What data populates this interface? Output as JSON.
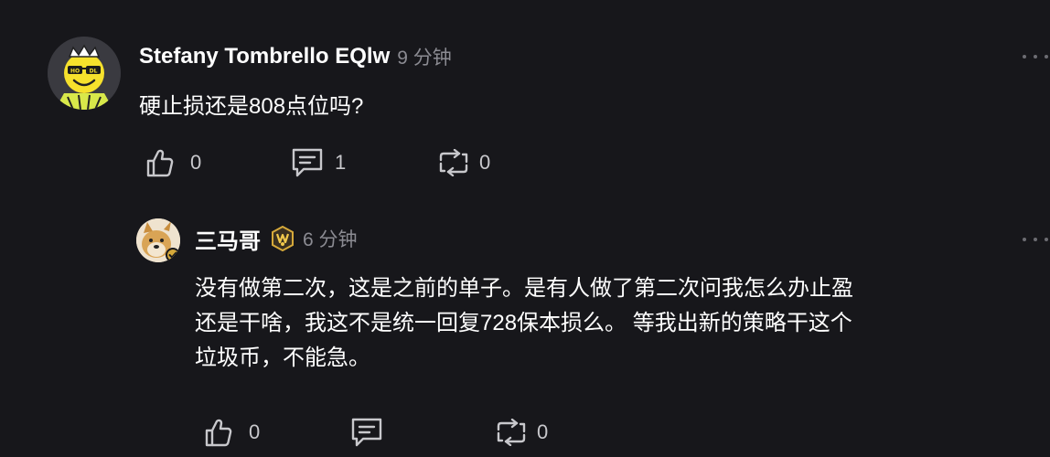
{
  "comments": [
    {
      "username": "Stefany Tombrello EQlw",
      "time": "9 分钟",
      "avatar_icon": "hodl-smiley-avatar",
      "body": "硬止损还是808点位吗?",
      "actions": {
        "likes": "0",
        "replies": "1",
        "reposts": "0"
      }
    },
    {
      "username": "三马哥",
      "badge_icon": "gold-hexagon-badge-icon",
      "time": "6 分钟",
      "avatar_icon": "doge-avatar",
      "body_lines": [
        "没有做第二次，这是之前的单子。是有人做了第二次问我怎么办止盈",
        "还是干啥，我这不是统一回复728保本损么。 等我出新的策略干这个",
        "垃圾币，不能急。"
      ],
      "actions": {
        "likes": "0",
        "reposts": "0"
      }
    }
  ],
  "colors": {
    "background": "#17171b",
    "text_primary": "#ffffff",
    "text_secondary": "#8b8b92",
    "icon": "#c8c8cc",
    "badge_gold": "#d6a93a"
  }
}
